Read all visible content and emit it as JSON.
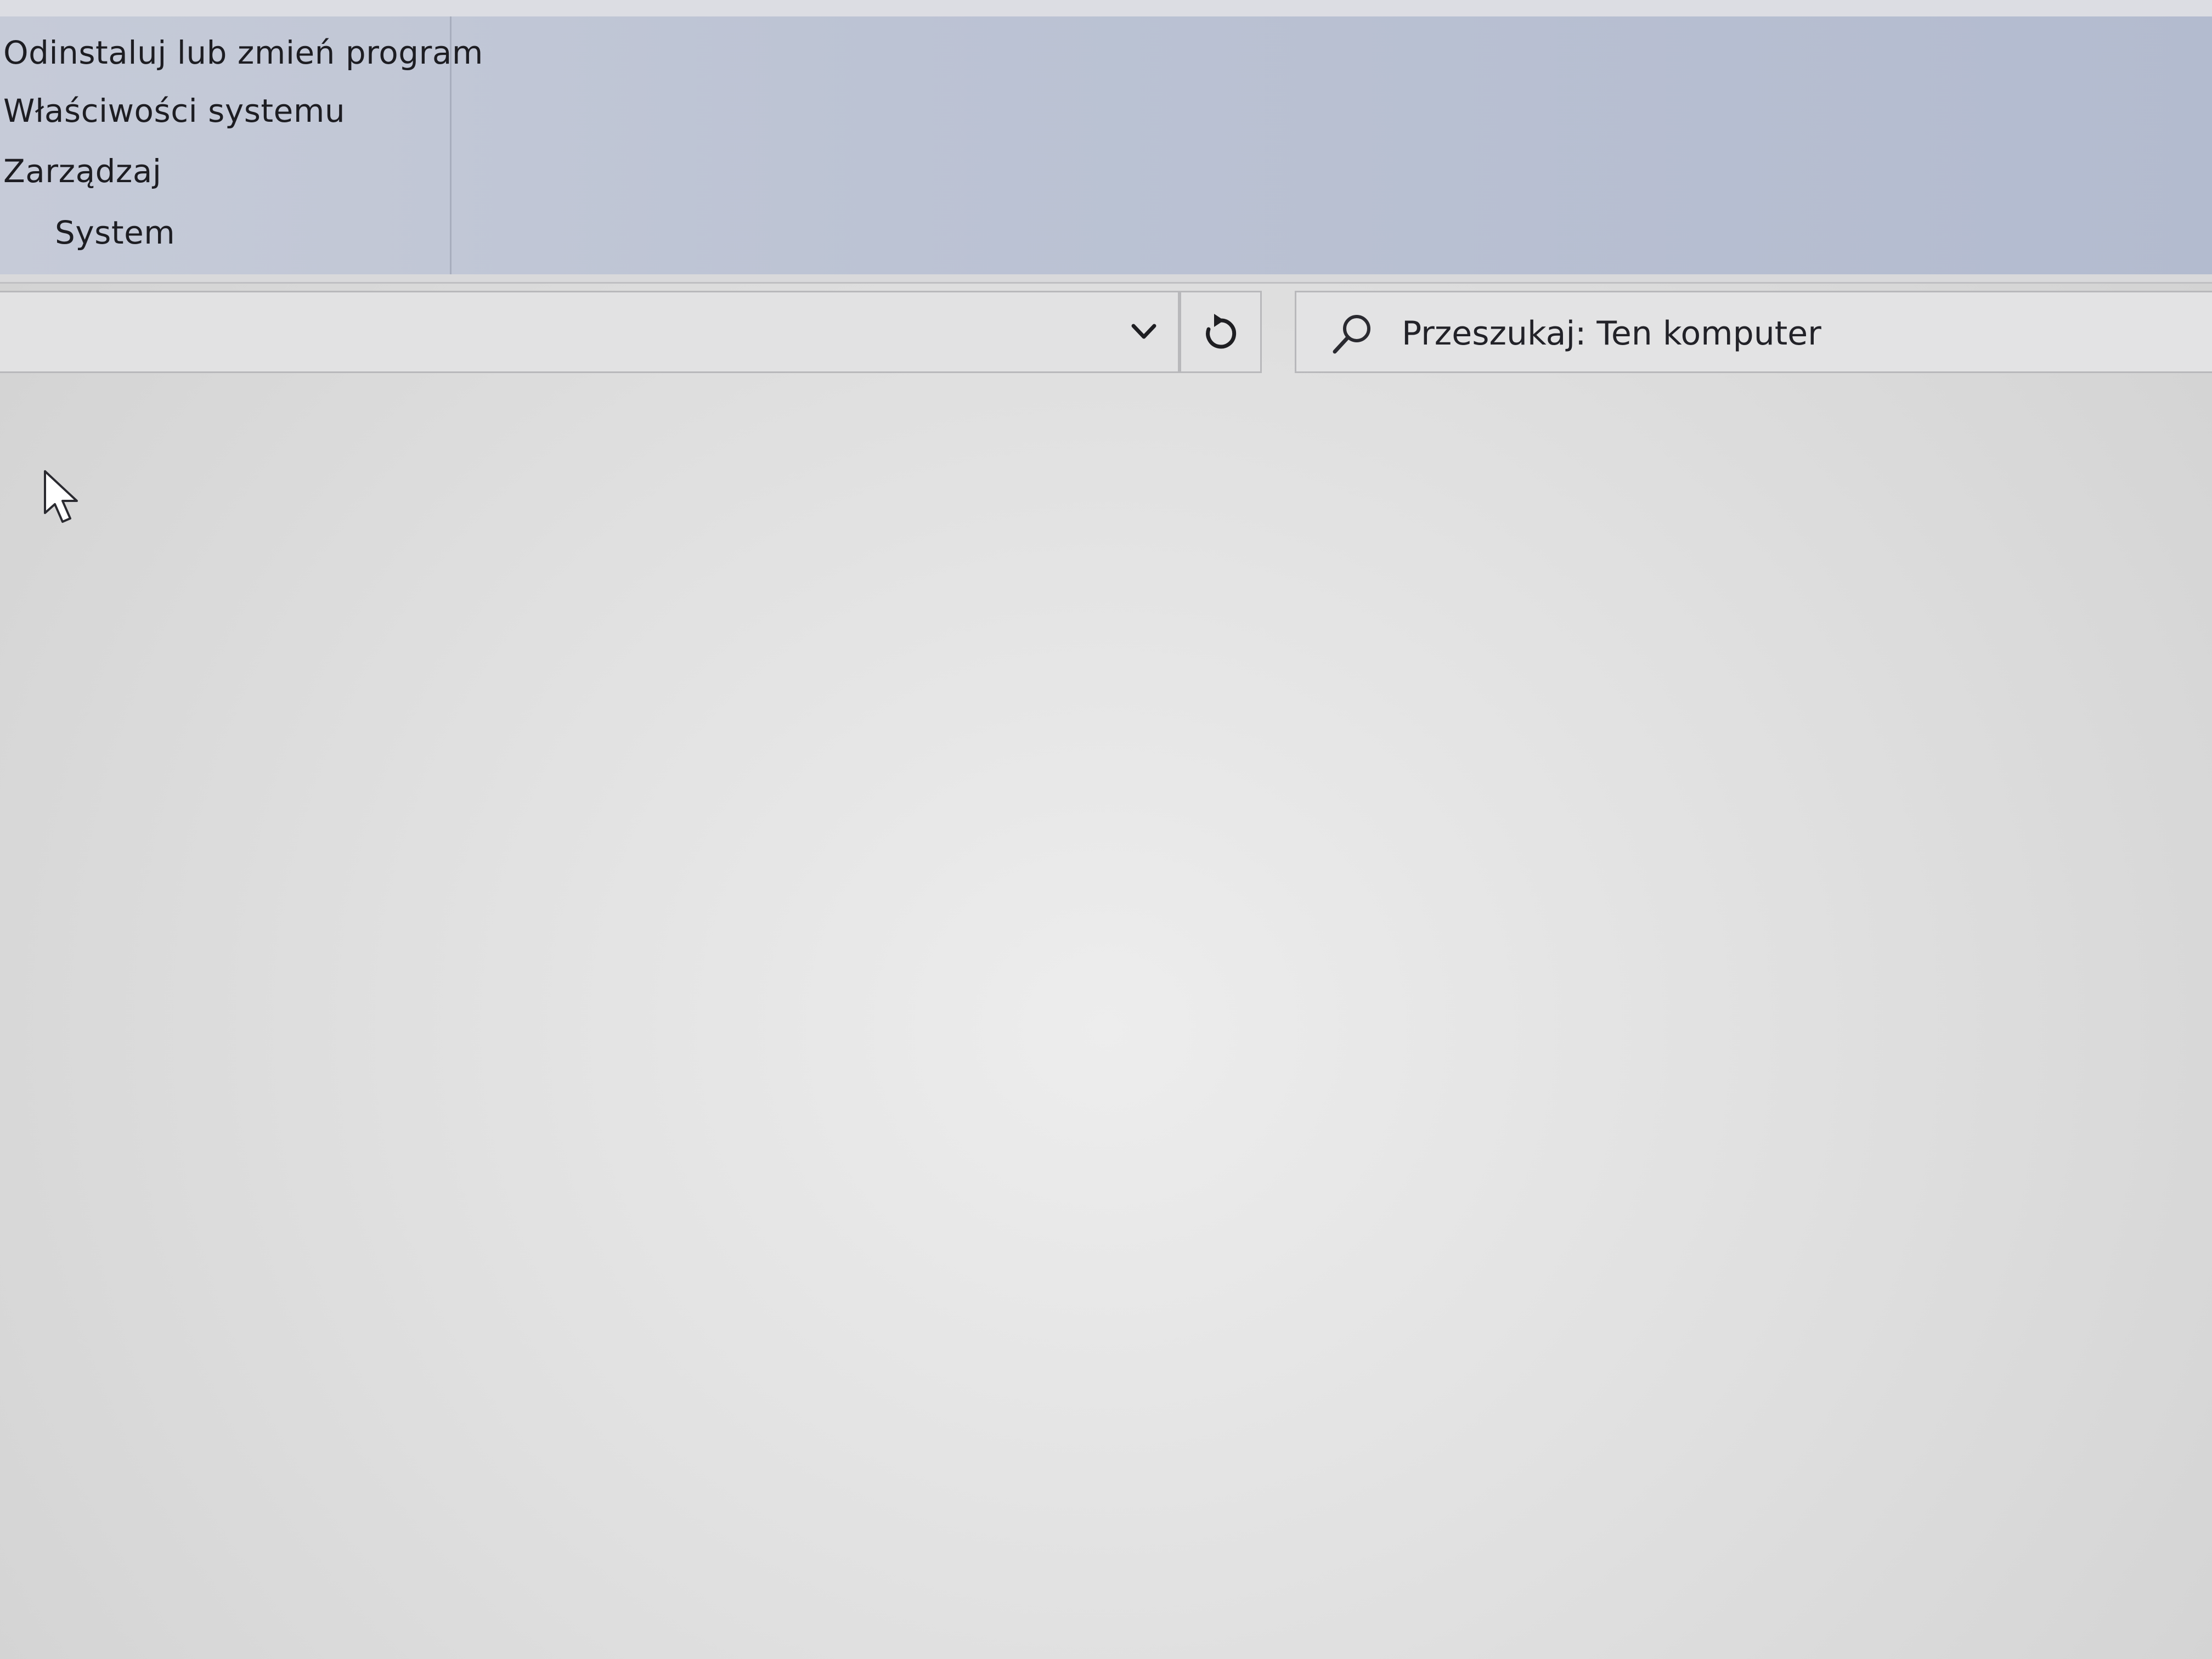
{
  "ribbon": {
    "items": [
      {
        "label": "Odinstaluj lub zmień program"
      },
      {
        "label": "Właściwości systemu"
      },
      {
        "label": "Zarządzaj"
      },
      {
        "label": "System"
      }
    ]
  },
  "address_bar": {
    "dropdown_icon": "chevron-down-icon",
    "refresh_icon": "refresh-icon"
  },
  "search": {
    "icon": "search-icon",
    "placeholder": "Przeszukaj: Ten komputer"
  },
  "colors": {
    "ribbon_bg": "#bcc3d4",
    "content_bg": "#e0e0e0"
  }
}
